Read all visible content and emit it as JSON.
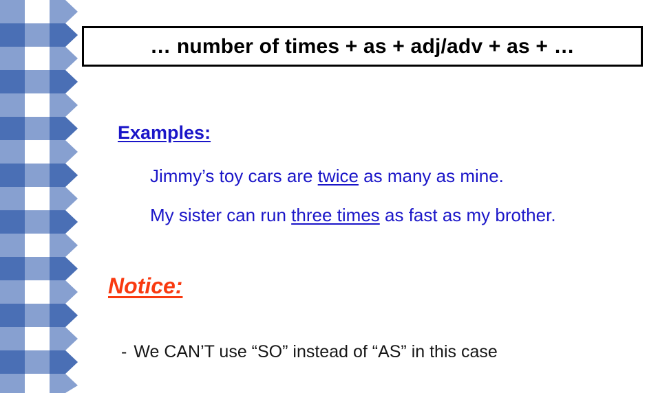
{
  "slide": {
    "title": "… number of times + as + adj/adv + as + …",
    "examples_heading": "Examples:",
    "examples": [
      {
        "before": "Jimmy’s toy cars are ",
        "emphasis": "twice",
        "after": " as many as mine."
      },
      {
        "before": "My sister can run ",
        "emphasis": "three times",
        "after": " as fast as my brother."
      }
    ],
    "notice_heading": "Notice:",
    "notice_items": [
      {
        "bullet": "-",
        "text": "We CAN’T use “SO” instead of “AS” in this case"
      }
    ]
  },
  "decoration": {
    "border_name": "gingham-zigzag-side-border",
    "colors": {
      "dark_blue": "#4a6fb5",
      "medium_blue": "#87a0d0",
      "light_blue": "#b6c5e4",
      "white": "#ffffff"
    }
  },
  "colors": {
    "title_text": "#000000",
    "title_border": "#000000",
    "body_blue": "#1a15c8",
    "notice_red": "#f93a10",
    "notice_body": "#161616",
    "background": "#ffffff"
  }
}
